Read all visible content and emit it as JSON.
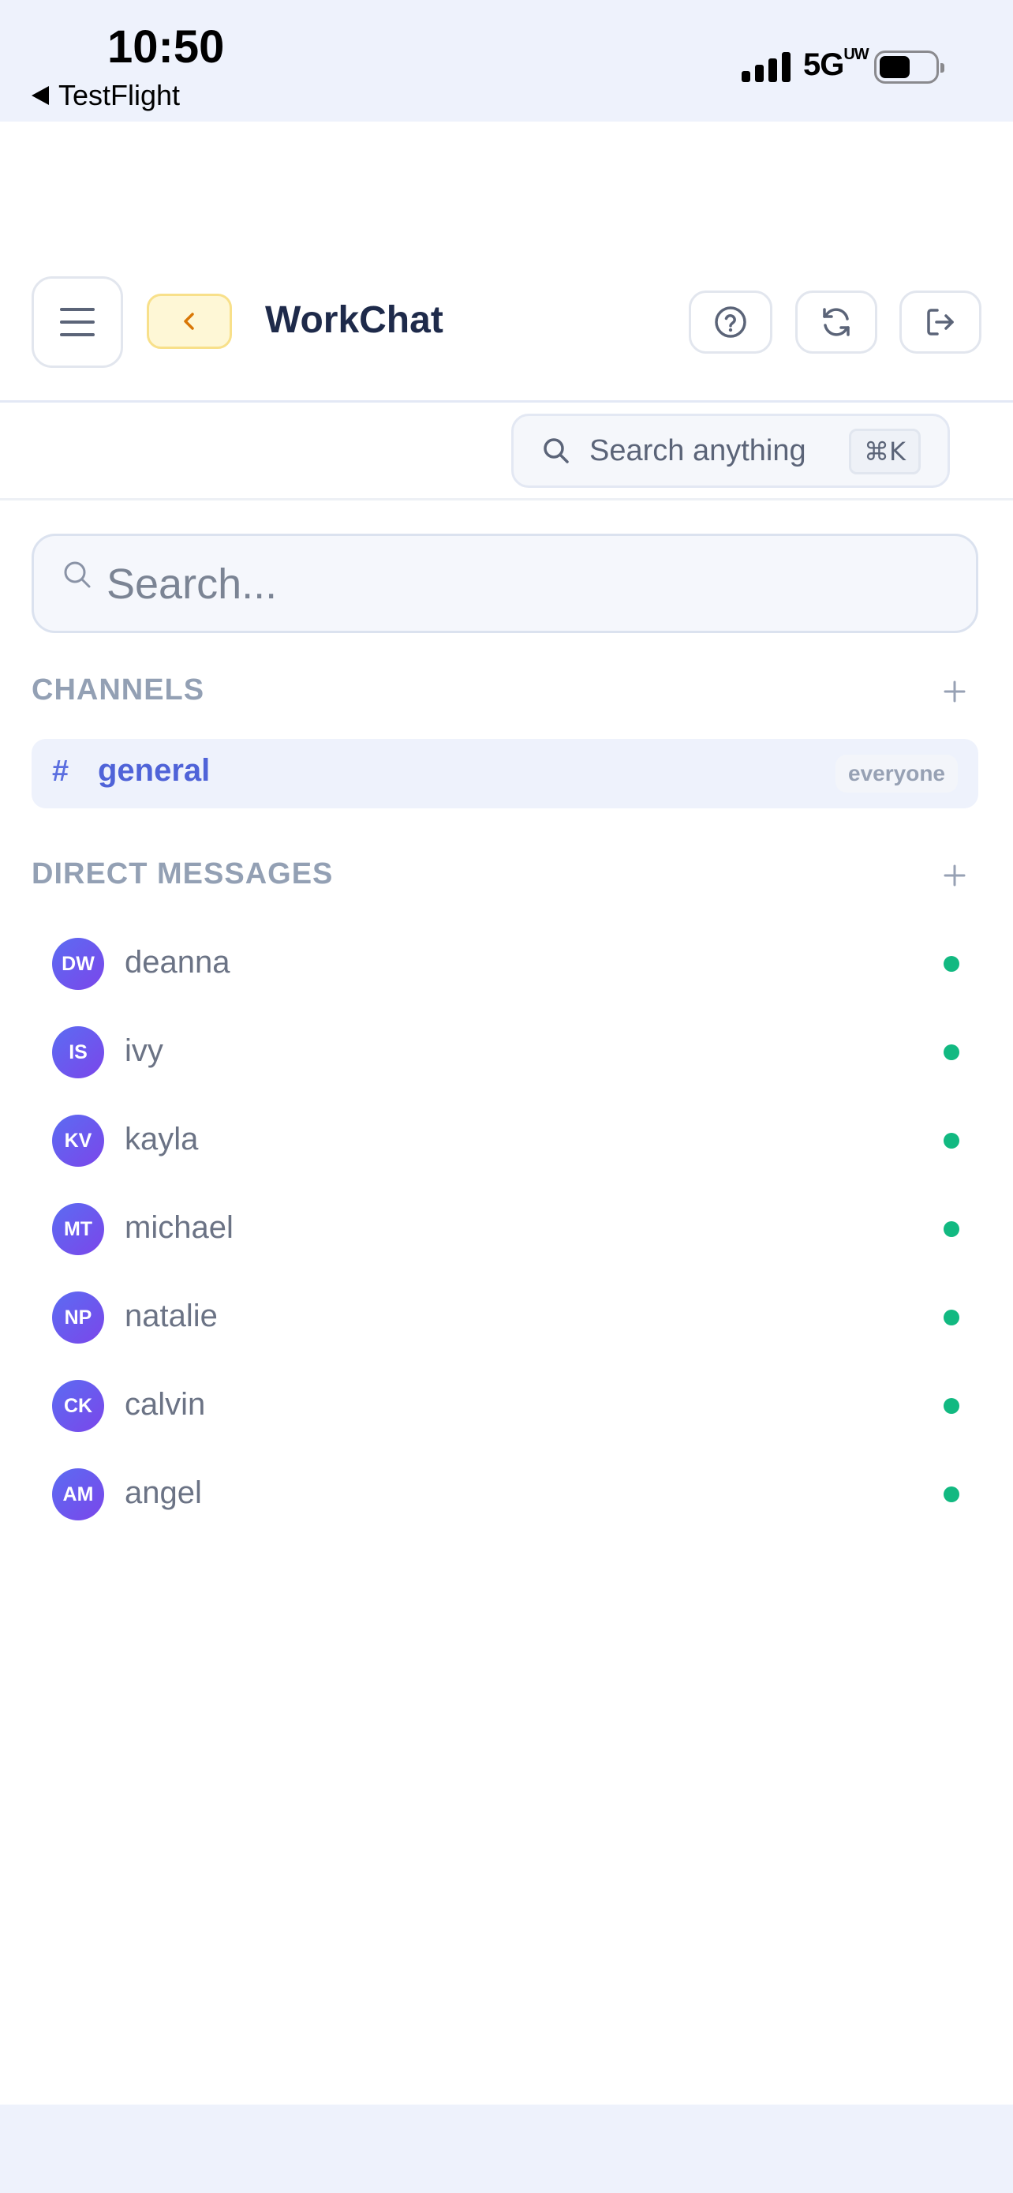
{
  "status_bar": {
    "time": "10:50",
    "back_app": "TestFlight",
    "network": "5G",
    "network_suffix": "UW"
  },
  "header": {
    "title": "WorkChat",
    "icons": {
      "menu": "menu-icon",
      "back": "chevron-left-icon",
      "help": "help-circle-icon",
      "refresh": "refresh-icon",
      "logout": "logout-icon"
    }
  },
  "global_search": {
    "label": "Search anything",
    "shortcut": "⌘K"
  },
  "sidebar": {
    "search_placeholder": "Search...",
    "channels_title": "CHANNELS",
    "channels": [
      {
        "name": "general",
        "badge": "everyone",
        "active": true
      }
    ],
    "dm_title": "DIRECT MESSAGES",
    "direct_messages": [
      {
        "initials": "DW",
        "name": "deanna",
        "online": true
      },
      {
        "initials": "IS",
        "name": "ivy",
        "online": true
      },
      {
        "initials": "KV",
        "name": "kayla",
        "online": true
      },
      {
        "initials": "MT",
        "name": "michael",
        "online": true
      },
      {
        "initials": "NP",
        "name": "natalie",
        "online": true
      },
      {
        "initials": "CK",
        "name": "calvin",
        "online": true
      },
      {
        "initials": "AM",
        "name": "angel",
        "online": true
      }
    ]
  },
  "colors": {
    "accent": "#4f63d8",
    "online": "#12b981",
    "back_button_bg": "#fef7d6",
    "avatar_gradient_start": "#5b6cf2",
    "avatar_gradient_end": "#7b46ea"
  }
}
